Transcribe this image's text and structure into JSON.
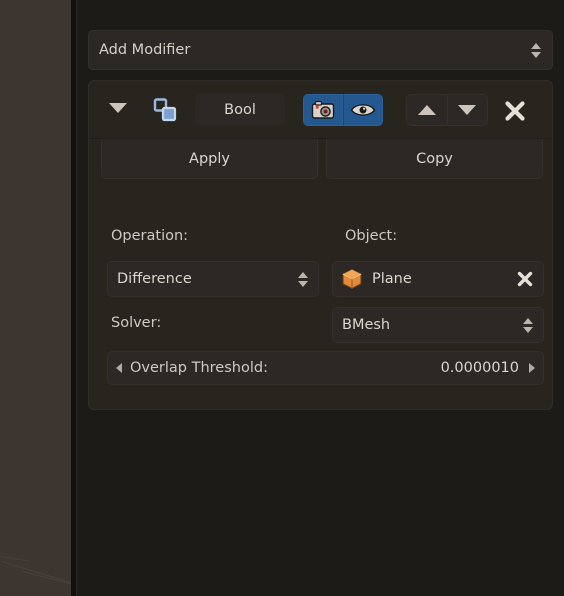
{
  "colors": {
    "viewport_bg": "#3d3630",
    "properties_bg": "#1d1b18",
    "panel_bg": "#28251f",
    "widget_bg": "#2b2825",
    "toggle_on_blue": "#24588f",
    "text": "#d4cdc5",
    "object_icon_orange": "#e08b3c",
    "modifier_icon_blue": "#9cb8de"
  },
  "add_modifier": {
    "label": "Add Modifier",
    "icon": "updown-arrows-icon"
  },
  "modifier": {
    "header": {
      "expand_icon": "triangle-down-icon",
      "type_icon": "boolean-modifier-icon",
      "name": "Bool",
      "render_toggle": {
        "icon": "camera-icon",
        "enabled": true
      },
      "viewport_toggle": {
        "icon": "eye-icon",
        "enabled": true
      },
      "move_up_icon": "triangle-up-icon",
      "move_down_icon": "triangle-down-icon",
      "delete_icon": "close-x-icon"
    },
    "apply_label": "Apply",
    "copy_label": "Copy",
    "operation": {
      "label": "Operation:",
      "value": "Difference"
    },
    "object": {
      "label": "Object:",
      "icon": "mesh-cube-icon",
      "value": "Plane",
      "clear_icon": "close-x-icon"
    },
    "solver": {
      "label": "Solver:",
      "value": "BMesh"
    },
    "overlap_threshold": {
      "label": "Overlap Threshold:",
      "value": "0.0000010",
      "left_arrow_icon": "triangle-left-icon",
      "right_arrow_icon": "triangle-right-icon"
    }
  }
}
